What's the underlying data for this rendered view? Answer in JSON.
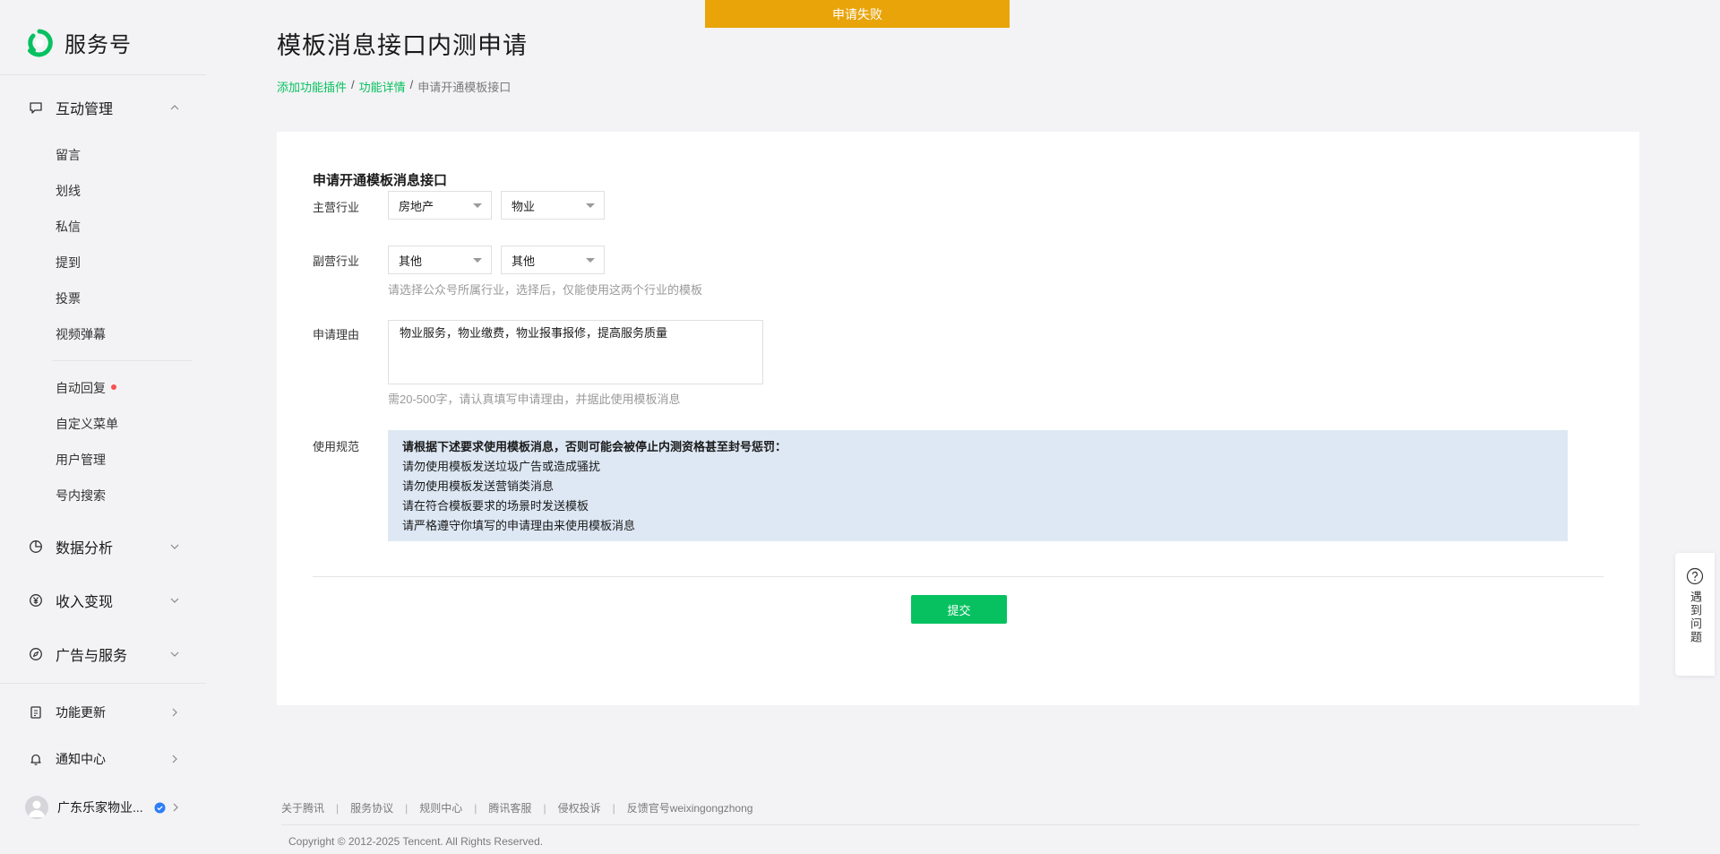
{
  "app": {
    "name": "服务号"
  },
  "sidebar": {
    "groups": {
      "interaction": {
        "label": "互动管理",
        "icon": "chat-bubble-icon",
        "expanded": true
      },
      "data": {
        "label": "数据分析",
        "icon": "pie-chart-icon"
      },
      "income": {
        "label": "收入变现",
        "icon": "yen-icon"
      },
      "ads": {
        "label": "广告与服务",
        "icon": "compass-icon"
      },
      "updates": {
        "label": "功能更新",
        "icon": "document-icon"
      },
      "notices": {
        "label": "通知中心",
        "icon": "bell-icon"
      }
    },
    "sub_items": [
      "留言",
      "划线",
      "私信",
      "提到",
      "投票",
      "视频弹幕",
      "自动回复",
      "自定义菜单",
      "用户管理",
      "号内搜索"
    ],
    "account_name": "广东乐家物业..."
  },
  "toast": {
    "text": "申请失败",
    "color": "#e9a40a"
  },
  "page": {
    "title": "模板消息接口内测申请",
    "breadcrumb": {
      "link1": "添加功能插件",
      "link2": "功能详情",
      "current": "申请开通模板接口"
    }
  },
  "form": {
    "title": "申请开通模板消息接口",
    "main_industry": {
      "label": "主营行业",
      "primary": "房地产",
      "secondary": "物业"
    },
    "sub_industry": {
      "label": "副营行业",
      "primary": "其他",
      "secondary": "其他",
      "hint": "请选择公众号所属行业，选择后，仅能使用这两个行业的模板"
    },
    "reason": {
      "label": "申请理由",
      "value": "物业服务，物业缴费，物业报事报修，提高服务质量",
      "hint": "需20-500字，请认真填写申请理由，并据此使用模板消息"
    },
    "rules": {
      "label": "使用规范",
      "heading": "请根据下述要求使用模板消息，否则可能会被停止内测资格甚至封号惩罚：",
      "items": [
        "请勿使用模板发送垃圾广告或造成骚扰",
        "请勿使用模板发送营销类消息",
        "请在符合模板要求的场景时发送模板",
        "请严格遵守你填写的申请理由来使用模板消息"
      ]
    },
    "submit_label": "提交"
  },
  "footer": {
    "links": [
      "关于腾讯",
      "服务协议",
      "规则中心",
      "腾讯客服",
      "侵权投诉",
      "反馈官号weixingongzhong"
    ],
    "copyright": "Copyright © 2012-2025 Tencent. All Rights Reserved."
  },
  "help": {
    "text": "遇到问题",
    "icon": "question-circle-icon"
  },
  "colors": {
    "brand_green": "#07c160",
    "toast_orange": "#e9a40a",
    "rules_bg": "#dde8f4"
  }
}
